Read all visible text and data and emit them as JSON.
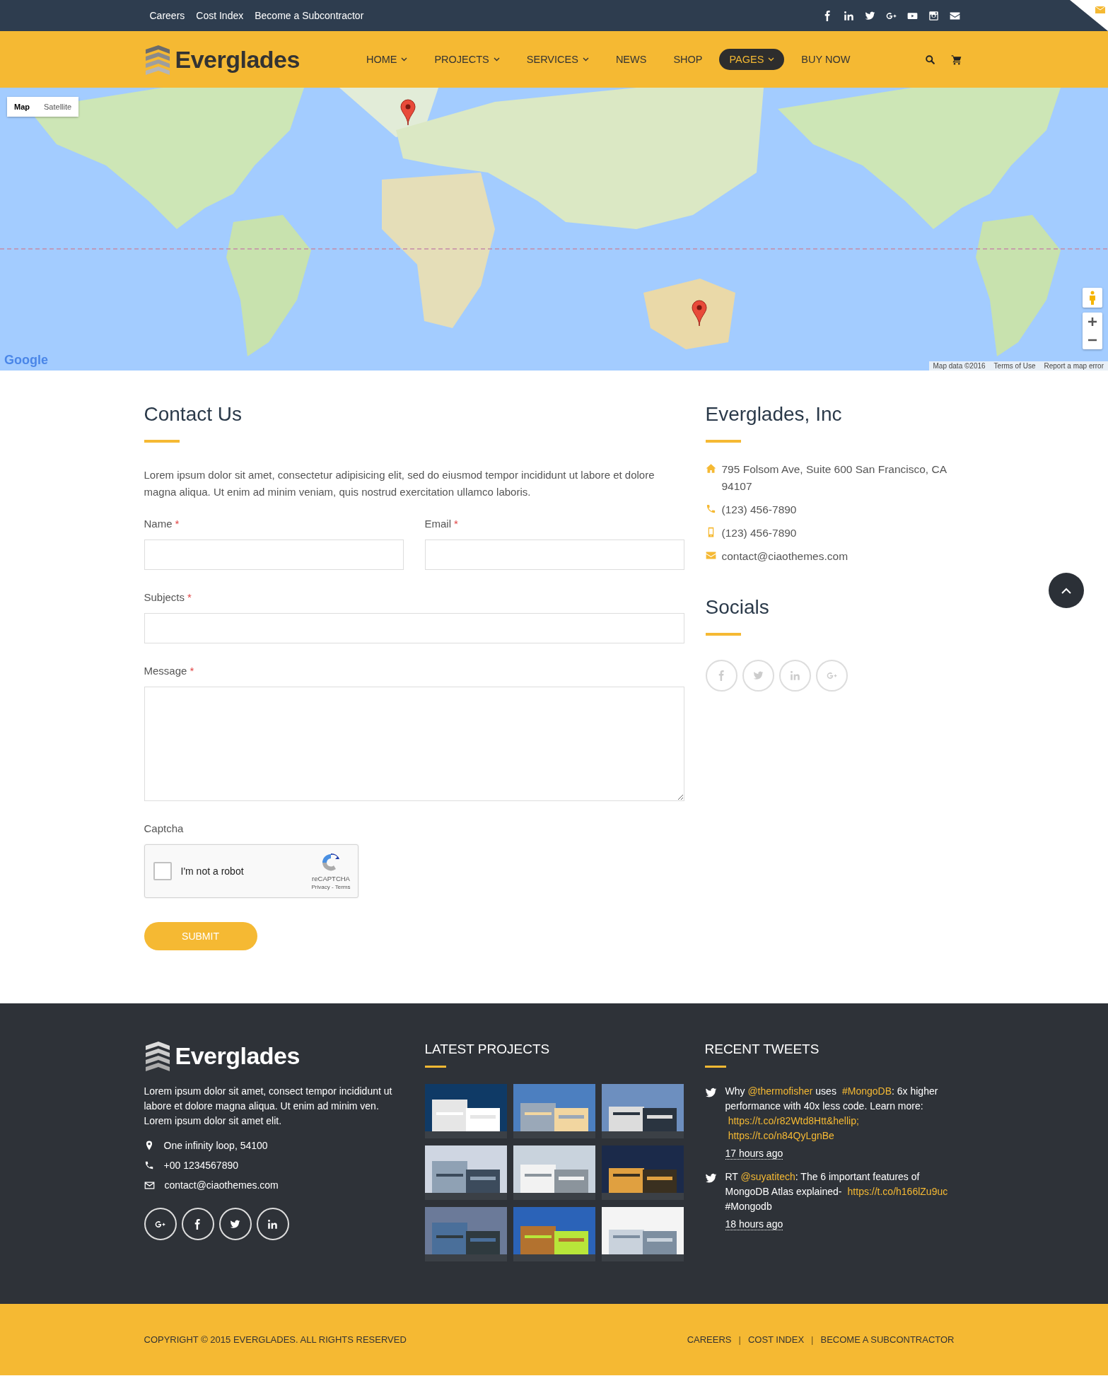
{
  "top_bar": {
    "links": [
      "Careers",
      "Cost Index",
      "Become a Subcontractor"
    ]
  },
  "nav": {
    "logo": "Everglades",
    "items": [
      {
        "label": "HOME",
        "dropdown": true,
        "selected": false
      },
      {
        "label": "PROJECTS",
        "dropdown": true,
        "selected": false
      },
      {
        "label": "SERVICES",
        "dropdown": true,
        "selected": false
      },
      {
        "label": "NEWS",
        "dropdown": false,
        "selected": false
      },
      {
        "label": "SHOP",
        "dropdown": false,
        "selected": false
      },
      {
        "label": "PAGES",
        "dropdown": true,
        "selected": true
      },
      {
        "label": "BUY NOW",
        "dropdown": false,
        "selected": false
      }
    ]
  },
  "map": {
    "type_buttons": [
      {
        "label": "Map",
        "selected": true
      },
      {
        "label": "Satellite",
        "selected": false
      }
    ],
    "logo": "Google",
    "attribution": [
      "Map data ©2016",
      "Terms of Use",
      "Report a map error"
    ]
  },
  "contact": {
    "title": "Contact Us",
    "intro": "Lorem ipsum dolor sit amet, consectetur adipisicing elit, sed do eiusmod tempor incididunt ut labore et dolore magna aliqua. Ut enim ad minim veniam, quis nostrud exercitation ullamco laboris.",
    "fields": [
      {
        "label": "Name",
        "required_mark": "*",
        "kind": "half"
      },
      {
        "label": "Email",
        "required_mark": "*",
        "kind": "half"
      },
      {
        "label": "Subjects",
        "required_mark": "*",
        "kind": "full"
      },
      {
        "label": "Message",
        "required_mark": "*",
        "kind": "textarea"
      }
    ],
    "captcha": {
      "label": "Captcha",
      "checkbox_label": "I'm not a robot",
      "checked": false,
      "brand": "reCAPTCHA",
      "links": "Privacy - Terms"
    },
    "submit": "SUBMIT"
  },
  "company": {
    "title": "Everglades, Inc",
    "details": [
      {
        "kind": "address",
        "text": "795 Folsom Ave, Suite 600 San Francisco, CA 94107"
      },
      {
        "kind": "phone",
        "text": "(123) 456-7890"
      },
      {
        "kind": "mobile",
        "text": "(123) 456-7890"
      },
      {
        "kind": "email",
        "text": "contact@ciaothemes.com"
      }
    ]
  },
  "socials": {
    "title": "Socials"
  },
  "footer": {
    "logo": "Everglades",
    "about": "Lorem ipsum dolor sit amet, consect tempor incididunt ut labore et dolore magna aliqua. Ut enim ad minim ven. Lorem ipsum dolor sit amet elit.",
    "contacts": [
      {
        "kind": "location",
        "text": "One infinity loop, 54100"
      },
      {
        "kind": "phone",
        "text": "+00 1234567890"
      },
      {
        "kind": "email",
        "text": "contact@ciaothemes.com"
      }
    ],
    "projects_title": "LATEST PROJECTS",
    "tweets_title": "RECENT TWEETS",
    "tweets": [
      {
        "parts": [
          {
            "kind": "text",
            "text": "Why "
          },
          {
            "kind": "link",
            "text": "@thermofisher"
          },
          {
            "kind": "text",
            "text": " uses "
          },
          {
            "kind": "link",
            "text": "#MongoDB"
          },
          {
            "kind": "text",
            "text": ": 6x higher performance with 40x less code. Learn more: "
          },
          {
            "kind": "link",
            "text": "https://t.co/r82Wtd8Htt&hellip;"
          },
          {
            "kind": "link",
            "text": "https://t.co/n84QyLgnBe"
          }
        ],
        "time": "17 hours ago"
      },
      {
        "parts": [
          {
            "kind": "text",
            "text": "RT "
          },
          {
            "kind": "link",
            "text": "@suyatitech"
          },
          {
            "kind": "text",
            "text": ": The 6 important features of MongoDB Atlas explained- "
          },
          {
            "kind": "link",
            "text": "https://t.co/h166lZu9uc"
          },
          {
            "kind": "text",
            "text": " #Mongodb"
          }
        ],
        "time": "18 hours ago"
      }
    ]
  },
  "bottom_bar": {
    "copyright": "COPYRIGHT © 2015 EVERGLADES. ALL RIGHTS RESERVED",
    "links": [
      {
        "kind": "link",
        "text": "CAREERS"
      },
      {
        "kind": "separator",
        "text": "|"
      },
      {
        "kind": "link",
        "text": "COST INDEX"
      },
      {
        "kind": "separator",
        "text": "|"
      },
      {
        "kind": "link",
        "text": "BECOME A SUBCONTRACTOR"
      }
    ]
  }
}
